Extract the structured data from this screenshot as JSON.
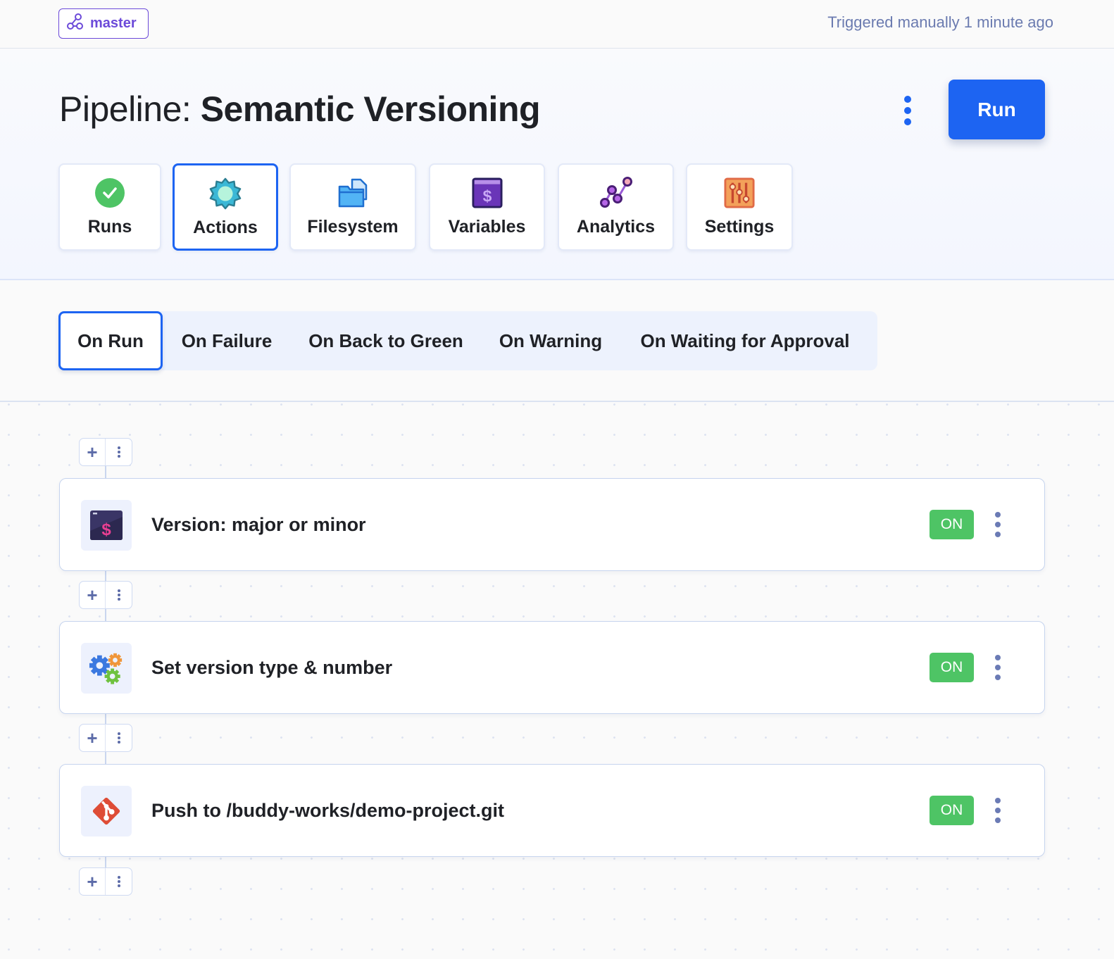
{
  "topbar": {
    "branch": "master",
    "branch_icon": "branch-icon",
    "triggered": "Triggered manually 1 minute ago"
  },
  "header": {
    "title_prefix": "Pipeline:",
    "title_name": "Semantic Versioning",
    "more_icon": "vertical-dots-icon",
    "run_label": "Run",
    "accent": "#1d64f2"
  },
  "nav": {
    "active": "Actions",
    "tabs": [
      {
        "label": "Runs",
        "icon": "check-circle-icon"
      },
      {
        "label": "Actions",
        "icon": "gear-icon"
      },
      {
        "label": "Filesystem",
        "icon": "folder-icon"
      },
      {
        "label": "Variables",
        "icon": "dollar-window-icon"
      },
      {
        "label": "Analytics",
        "icon": "graph-icon"
      },
      {
        "label": "Settings",
        "icon": "sliders-icon"
      }
    ]
  },
  "triggers": {
    "active": "On Run",
    "tabs": [
      {
        "label": "On Run"
      },
      {
        "label": "On Failure"
      },
      {
        "label": "On Back to Green"
      },
      {
        "label": "On Warning"
      },
      {
        "label": "On Waiting for Approval"
      }
    ]
  },
  "actions": [
    {
      "title": "Version: major or minor",
      "icon": "terminal-dollar-icon",
      "status": "ON"
    },
    {
      "title": "Set version type & number",
      "icon": "gears-icon",
      "status": "ON"
    },
    {
      "title": "Push to /buddy-works/demo-project.git",
      "icon": "git-icon",
      "status": "ON"
    }
  ],
  "add_box": {
    "plus": "+",
    "plus_icon": "plus-icon",
    "menu_icon": "vertical-dots-icon"
  },
  "colors": {
    "on_badge": "#4ec465",
    "branch": "#6c4ad9",
    "muted": "#6b7bb0"
  }
}
